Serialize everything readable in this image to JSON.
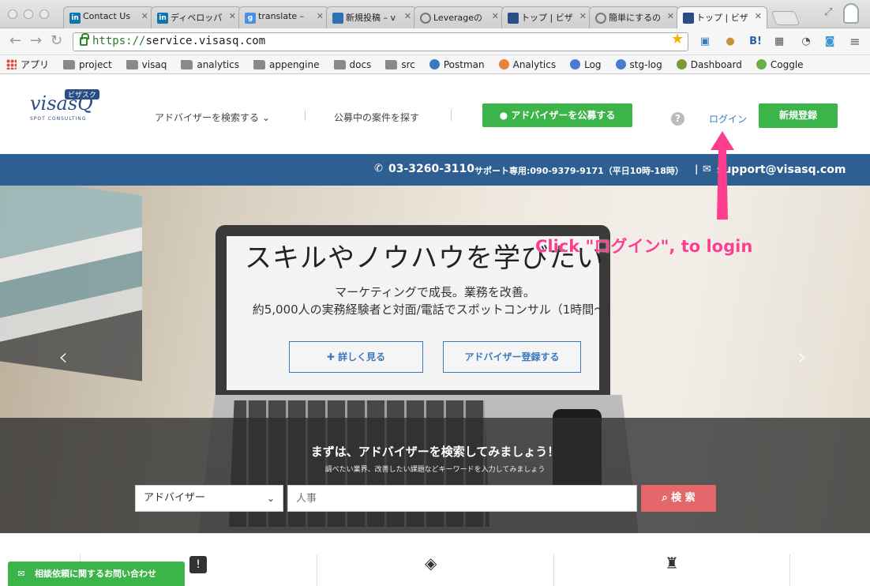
{
  "browser": {
    "tabs": [
      {
        "title": "Contact Us",
        "favicon": "in",
        "color": "#0e76a8",
        "active": false
      },
      {
        "title": "ディベロッパ",
        "favicon": "in",
        "color": "#0e76a8",
        "active": false
      },
      {
        "title": "translate – ",
        "favicon": "g",
        "color": "#4a90e2",
        "active": false
      },
      {
        "title": "新規投稿 – v",
        "favicon": "wp",
        "color": "#2e6fb5",
        "active": false
      },
      {
        "title": "Leverageの",
        "favicon": "loader",
        "color": "#777",
        "active": false
      },
      {
        "title": "トップ | ビザ",
        "favicon": "visasq",
        "color": "#2a4d86",
        "active": false
      },
      {
        "title": "簡単にするの",
        "favicon": "loader",
        "color": "#777",
        "active": false
      },
      {
        "title": "トップ | ビザ",
        "favicon": "visasq",
        "color": "#2a4d86",
        "active": true
      }
    ],
    "url_scheme": "https://",
    "url_host": "service.visasq.com",
    "bookmarks": [
      "アプリ",
      "project",
      "visaq",
      "analytics",
      "appengine",
      "docs",
      "src",
      "Postman",
      "Analytics",
      "Log",
      "stg-log",
      "Dashboard",
      "Coggle"
    ]
  },
  "header": {
    "logo_text": "visasQ",
    "logo_tag": "ビザスク",
    "logo_sub": "SPOT CONSULTING",
    "nav_search_advisor": "アドバイザーを検索する",
    "nav_find_projects": "公募中の案件を探す",
    "post_button": "アドバイザーを公募する",
    "login": "ログイン",
    "signup": "新規登録"
  },
  "contact_bar": {
    "phone": "03-3260-3110",
    "support_phone": "サポート専用:090-9379-9171（平日10時-18時）",
    "email": "support@visasq.com"
  },
  "hero": {
    "title": "スキルやノウハウを学びたい",
    "subtitle1": "マーケティングで成長。業務を改善。",
    "subtitle2": "約5,000人の実務経験者と対面/電話でスポットコンサル（1時間〜）",
    "details_button": "詳しく見る",
    "register_button": "アドバイザー登録する",
    "search_title": "まずは、アドバイザーを検索してみましょう！",
    "search_hint": "調べたい業界、改善したい課題などキーワードを入力してみましょう",
    "select_value": "アドバイザー",
    "query_placeholder": "人事",
    "search_button": "検 索"
  },
  "annotation": "Click \"ログイン\", to login",
  "chat_button": "相談依頼に関するお問い合わせ",
  "colors": {
    "brand_green": "#3bb54a",
    "brand_blue": "#2d5f93",
    "annotation_pink": "#ff3d8f",
    "search_red": "#e3676b"
  }
}
